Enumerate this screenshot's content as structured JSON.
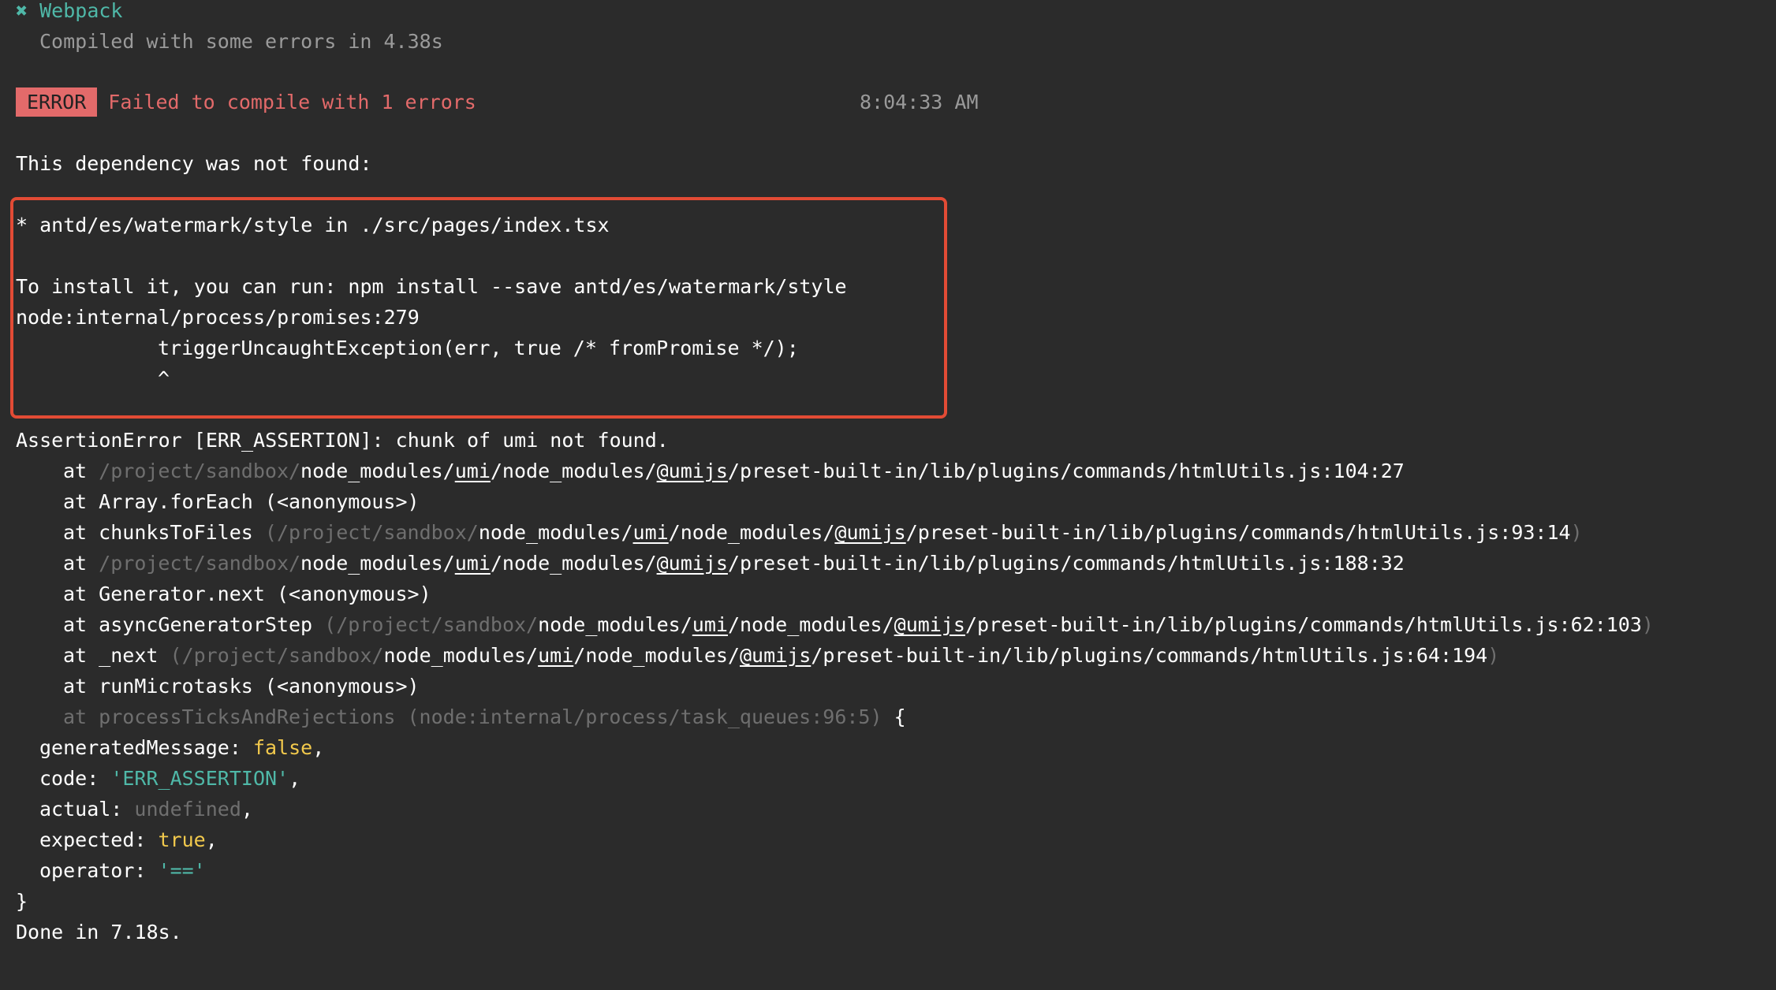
{
  "header": {
    "status_icon": "✖",
    "title": "Webpack",
    "subtitle": "Compiled with some errors in 4.38s"
  },
  "error_line": {
    "badge": "ERROR",
    "message": "Failed to compile with 1 errors",
    "timestamp": "8:04:33 AM"
  },
  "dependency_heading": "This dependency was not found:",
  "highlight": {
    "missing": "* antd/es/watermark/style in ./src/pages/index.tsx",
    "install_hint": "To install it, you can run: npm install --save antd/es/watermark/style",
    "location": "node:internal/process/promises:279",
    "code": "triggerUncaughtException(err, true /* fromPromise */);",
    "caret": "^"
  },
  "assertion": "AssertionError [ERR_ASSERTION]: chunk of umi not found.",
  "stack": {
    "at": "at",
    "anon": "(<anonymous>)",
    "sandbox": "/project/sandbox/",
    "nm": "node_modules/",
    "umi": "umi",
    "nm_slash": "/node_modules/",
    "umijs": "@umijs",
    "tail": "/preset-built-in/lib/plugins/commands/htmlUtils.js",
    "lines": [
      {
        "fn": "",
        "pos": ":104:27"
      },
      {
        "fn": "Array.forEach"
      },
      {
        "fn": "chunksToFiles",
        "pos": ":93:14"
      },
      {
        "fn": "",
        "pos": ":188:32"
      },
      {
        "fn": "Generator.next"
      },
      {
        "fn": "asyncGeneratorStep",
        "pos": ":62:103"
      },
      {
        "fn": "_next",
        "pos": ":64:194"
      },
      {
        "fn": "runMicrotasks"
      }
    ],
    "process_ticks": "at processTicksAndRejections (node:internal/process/task_queues:96:5)",
    "open_brace": "{"
  },
  "error_object": {
    "generatedMessage_key": "generatedMessage:",
    "generatedMessage_val": "false",
    "code_key": "code:",
    "code_val": "'ERR_ASSERTION'",
    "actual_key": "actual:",
    "actual_val": "undefined",
    "expected_key": "expected:",
    "expected_val": "true",
    "operator_key": "operator:",
    "operator_val": "'=='",
    "close_brace": "}"
  },
  "footer": "Done in 7.18s.",
  "colors": {
    "background": "#2b2b2b",
    "error_red": "#e36a6a",
    "highlight_border": "#e24b35",
    "accent_cyan": "#4fb8a8",
    "boolean_yellow": "#f2c94c"
  }
}
